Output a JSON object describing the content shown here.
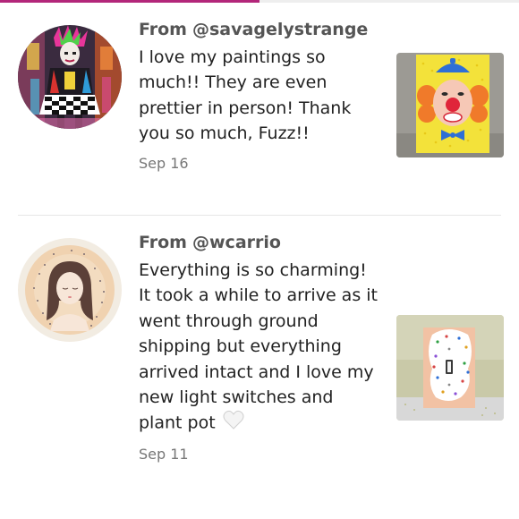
{
  "accent_color": "#b3267a",
  "reviews": [
    {
      "from_prefix": "From",
      "username": "@savagelystrange",
      "text": "I love my paintings so much!! They are even prettier in person! Thank you so much, Fuzz!!",
      "date": "Sep 16",
      "avatar_icon": "punk-art-avatar",
      "thumbnail_icon": "clown-painting-thumbnail"
    },
    {
      "from_prefix": "From",
      "username": "@wcarrio",
      "text": "Everything is so charming! It took a while to arrive as it went through ground shipping but everything arrived intact and I love my new light switches and plant pot",
      "emoji": "white-heart",
      "date": "Sep 11",
      "avatar_icon": "illustrated-girl-avatar",
      "thumbnail_icon": "light-switch-plate-thumbnail"
    }
  ]
}
